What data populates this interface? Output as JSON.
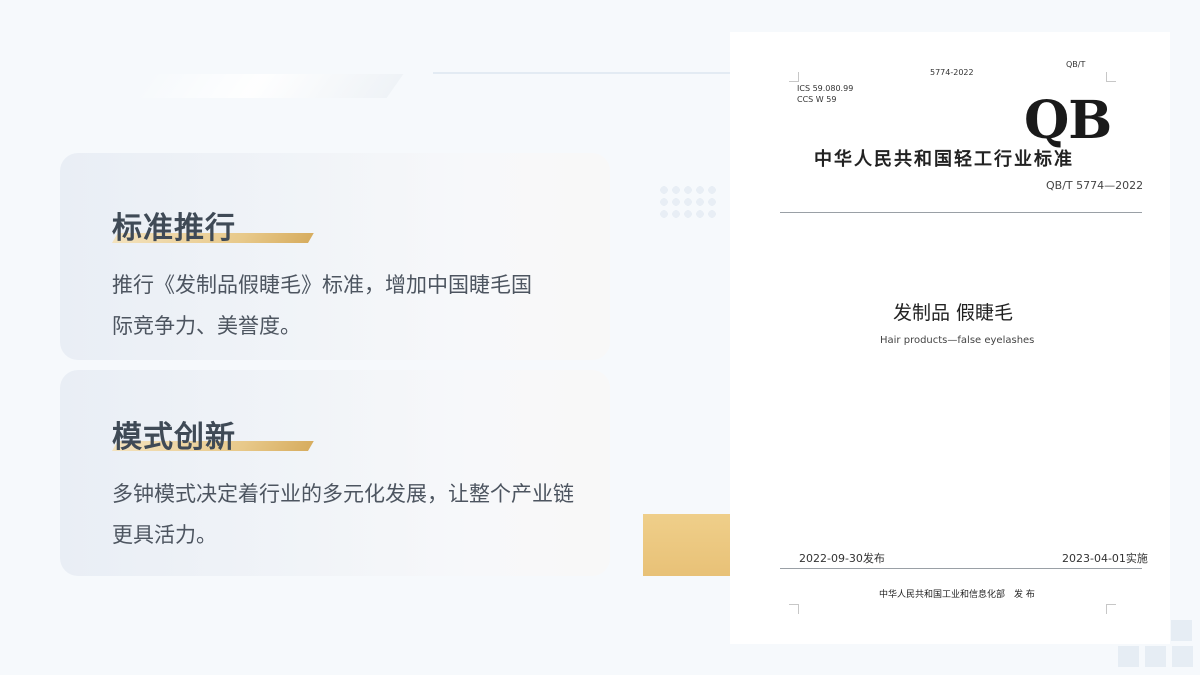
{
  "cards": [
    {
      "title": "标准推行",
      "body_lines": [
        "推行《发制品假睫毛》标准，增加中国睫毛国",
        "际竞争力、美誉度。"
      ]
    },
    {
      "title": "模式创新",
      "body_lines": [
        "多钟模式决定着行业的多元化发展，让整个产业链",
        "更具活力。"
      ]
    }
  ],
  "document": {
    "number_top": "5774-2022",
    "corner_code": "QB/T",
    "ics": "ICS 59.080.99",
    "ccs": "CCS W 59",
    "logo": "QB",
    "organization": "中华人民共和国轻工行业标准",
    "code": "QB/T 5774—2022",
    "title_cn": "发制品 假睫毛",
    "title_en": "Hair products—false eyelashes",
    "issue_date": "2022-09-30发布",
    "implement_date": "2023-04-01实施",
    "publisher": "中华人民共和国工业和信息化部　发 布"
  },
  "colors": {
    "accent_gold": "#e8c177",
    "title_text": "#3f4a56",
    "body_text": "#4d5560",
    "background": "#f6f9fc"
  }
}
